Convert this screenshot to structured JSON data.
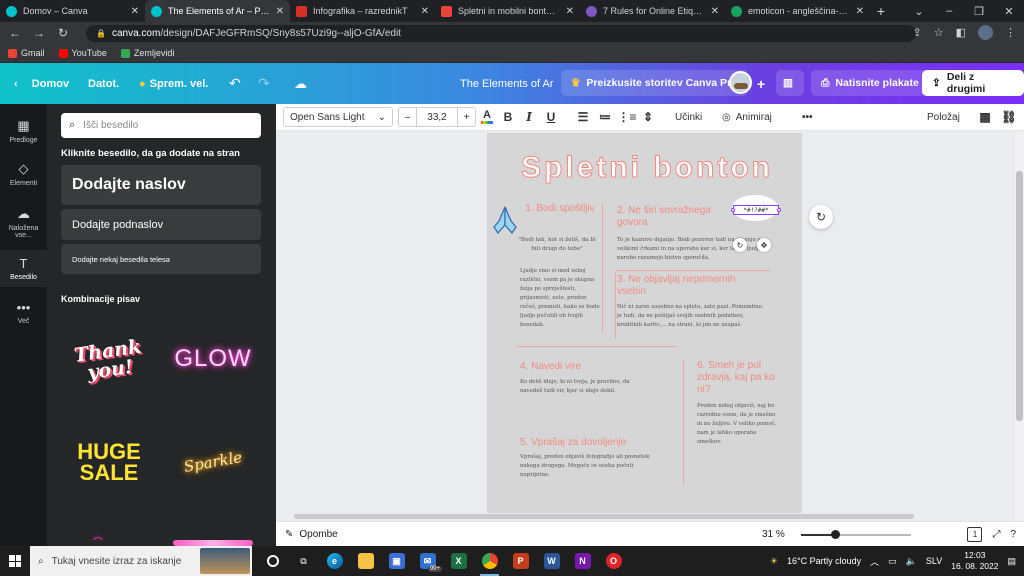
{
  "browser": {
    "tabs": [
      {
        "title": "Domov – Canva",
        "color": "#00c4cc",
        "active": false
      },
      {
        "title": "The Elements of Ar – Poster",
        "color": "#00c4cc",
        "active": true
      },
      {
        "title": "Infografika – razrednikT",
        "color": "#d93025",
        "active": false
      },
      {
        "title": "Spletni in mobilni bonton oz.",
        "color": "#e8453c",
        "active": false
      },
      {
        "title": "7 Rules for Online Etiquette -",
        "color": "#7e57c2",
        "active": false
      },
      {
        "title": "emoticon - angleščina-sloven",
        "color": "#1aa260",
        "active": false
      }
    ],
    "tab_close": "✕",
    "new_tab": "+",
    "url_host": "canva.com",
    "url_path": "/design/DAFJeGFRmSQ/Sny8s57Uzi9g--aljO-GfA/edit",
    "bookmarks": [
      {
        "label": "Gmail",
        "color": "#ea4335"
      },
      {
        "label": "YouTube",
        "color": "#ff0000"
      },
      {
        "label": "Zemljevidi",
        "color": "#34a853"
      }
    ]
  },
  "header": {
    "home": "Domov",
    "file": "Datot.",
    "resize": "Sprem. vel.",
    "design_title": "The Elements of Ar",
    "pro_cta": "Preizkusite storitev Canva Pro",
    "print": "Natisnite plakate",
    "share": "Deli z drugimi"
  },
  "rail": [
    {
      "label": "Predloge",
      "icon": "▦"
    },
    {
      "label": "Elementi",
      "icon": "◇"
    },
    {
      "label": "Naložena vse...",
      "icon": "☁"
    },
    {
      "label": "Besedilo",
      "icon": "T"
    },
    {
      "label": "Več",
      "icon": "•••"
    }
  ],
  "panel": {
    "search_placeholder": "Išči besedilo",
    "hint": "Kliknite besedilo, da ga dodate na stran",
    "add_heading": "Dodajte naslov",
    "add_subheading": "Dodajte podnaslov",
    "add_body": "Dodajte nekaj besedila telesa",
    "combos_title": "Kombinacije pisav",
    "combo_thank": "Thank you!",
    "combo_glow": "GLOW",
    "combo_huge": "HUGE SALE",
    "combo_sparkle": "Sparkle",
    "collapse": "‹"
  },
  "toolbar": {
    "font": "Open Sans Light",
    "font_caret": "⌄",
    "size_minus": "–",
    "size": "33,2",
    "size_plus": "+",
    "bold": "B",
    "italic": "I",
    "underline": "U",
    "effects": "Učinki",
    "animate": "Animiraj",
    "more": "•••",
    "position": "Položaj"
  },
  "poster": {
    "title": "Spletni bonton",
    "s1_heading": "1. Bodi spoštljiv",
    "s1_quote": "\"Bodi tak, kot si želiš, da bi bili drugi do tebe\"",
    "s1_body": "Ljudje smo si med seboj različni, vsem pa je skupna želja po spreještosti, prijaznosti, zato, preden rečeš, premisli, kako se bodo ljudje počutili ob tvojih besedah.",
    "s2_heading": "2. Ne širi sovražnega govora",
    "s2_body": "To je kaznivo dejanje. Bodi pozoren tudi na pisanje z velikimi črkami in na uporabo kar si, ker lahko ljudje narobe razumejo bistvo sporočila.",
    "s3_heading": "3. Ne objavljaj neprimernih vsebin",
    "s3_body": "Nič ni zares zasebno na spletu, zato pazi. Pomembno je tudi, da ne pošiljaš svojih osebnih podatkov, kreditnih kartic,... na strani, ki jim ne zaupaš.",
    "s4_heading": "4. Navedi vire",
    "s4_body": "Ko deliš idejo, ki ni tvoja, je pravilno, da navedeš tudi vir, kjer si idejo dobil.",
    "s5_heading": "5. Vprašaj za dovoljenje",
    "s5_body": "Vprašaj, preden objaviš fotografijo ali posnetek nekoga drugega. Mogoče se oseba počuti neprijetno.",
    "s6_heading": "6. Smeh je pol zdravja, kaj pa ko ni?",
    "s6_body": "Preden nekaj objaviš, naj bo razvidno vsem, da je smešno in ne žaljivo. V veliko pomoč, nam je lahko uporaba smeškov.",
    "selected_text": "*#!?##*",
    "accent": "#f08a80"
  },
  "bottom": {
    "notes": "Opombe",
    "zoom": "31 %",
    "zoom_fraction": 0.31,
    "page_count": "1"
  },
  "taskbar": {
    "search_placeholder": "Tukaj vnesite izraz za iskanje",
    "badge": "99+",
    "weather": "16°C  Partly cloudy",
    "lang": "SLV",
    "time": "12:03",
    "date": "16. 08. 2022"
  }
}
